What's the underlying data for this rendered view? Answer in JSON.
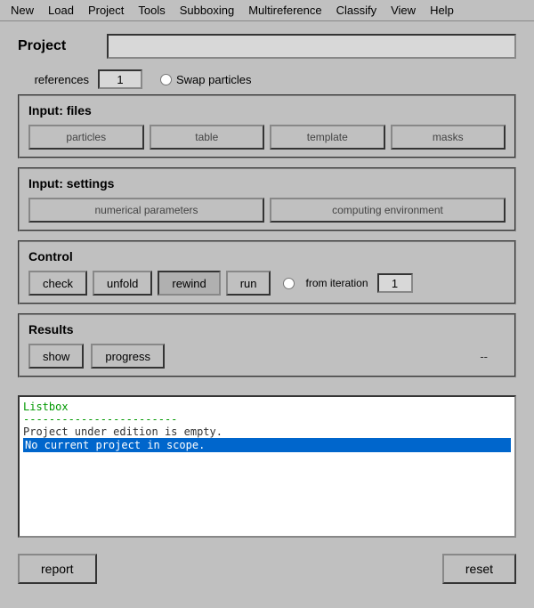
{
  "menubar": {
    "items": [
      "New",
      "Load",
      "Project",
      "Tools",
      "Subboxing",
      "Multireference",
      "Classify",
      "View",
      "Help"
    ]
  },
  "project": {
    "label": "Project",
    "input_value": "",
    "references_label": "references",
    "references_value": "1",
    "swap_particles_label": "Swap particles"
  },
  "input_files": {
    "title": "Input: files",
    "buttons": [
      "particles",
      "table",
      "template",
      "masks"
    ]
  },
  "input_settings": {
    "title": "Input: settings",
    "buttons": [
      "numerical parameters",
      "computing environment"
    ]
  },
  "control": {
    "title": "Control",
    "buttons": [
      "check",
      "unfold",
      "rewind",
      "run"
    ],
    "from_iteration_label": "from iteration",
    "iteration_value": "1"
  },
  "results": {
    "title": "Results",
    "buttons": [
      "show",
      "progress"
    ],
    "status": "--"
  },
  "listbox": {
    "label": "Listbox",
    "separator": "------------------------",
    "lines": [
      "Project under edition is empty.",
      "No current project in scope."
    ],
    "selected_index": 1
  },
  "bottom": {
    "report_label": "report",
    "reset_label": "reset"
  }
}
